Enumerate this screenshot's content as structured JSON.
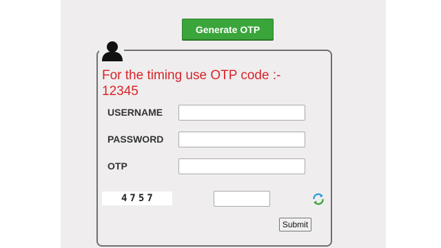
{
  "header": {
    "generate_otp_label": "Generate OTP"
  },
  "login": {
    "icon": "user-icon",
    "message_line1": "For the timing use OTP code :-",
    "message_line2": "12345",
    "username_label": "USERNAME",
    "username_value": "",
    "password_label": "PASSWORD",
    "password_value": "",
    "otp_label": "OTP",
    "otp_value": "",
    "captcha_code": "4757",
    "captcha_value": "",
    "refresh_icon": "refresh-icon",
    "submit_label": "Submit"
  },
  "colors": {
    "accent_green": "#3aa53a",
    "message_red": "#d8242a",
    "panel_bg": "#efedee"
  }
}
